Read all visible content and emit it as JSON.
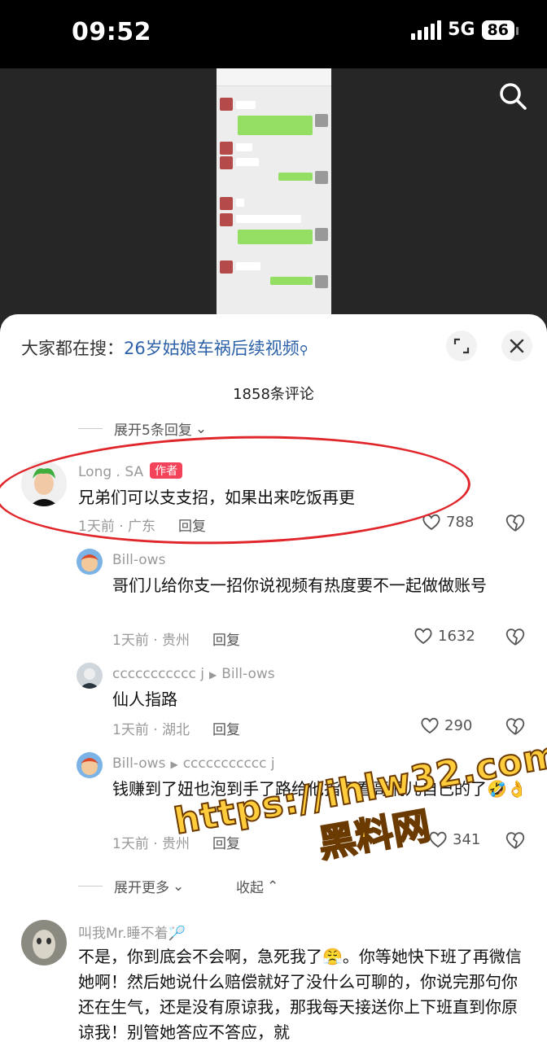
{
  "status_bar": {
    "time": "09:52",
    "network": "5G",
    "battery": "86"
  },
  "sheet": {
    "hot_search_label": "大家都在搜：",
    "hot_search_keyword": "26岁姑娘车祸后续视频",
    "comment_count": "1858条评论",
    "expand_top": "展开5条回复",
    "expand_more": "展开更多",
    "collapse": "收起"
  },
  "comments": [
    {
      "user": "Long . SA",
      "badge": "作者",
      "text": "兄弟们可以支支招，如果出来吃饭再更",
      "time_location": "1天前 · 广东",
      "reply": "回复",
      "likes": "788"
    },
    {
      "user": "Bill-ows",
      "text": "哥们儿给你支一招你说视频有热度要不一起做做账号",
      "time_location": "1天前 · 贵州",
      "reply": "回复",
      "likes": "1632"
    },
    {
      "user": "ccccccccccc j",
      "reply_to": "Bill-ows",
      "text": "仙人指路",
      "time_location": "1天前 · 湖北",
      "reply": "回复",
      "likes": "290"
    },
    {
      "user": "Bill-ows",
      "reply_to": "ccccccccccc j",
      "text": "钱赚到了妞也泡到手了路给他指了看哥们儿自己的了🤣👌",
      "time_location": "1天前 · 贵州",
      "reply": "回复",
      "likes": "341"
    },
    {
      "user": "叫我Mr.睡不着🏸",
      "text": "不是，你到底会不会啊，急死我了😤。你等她快下班了再微信她啊！然后她说什么赔偿就好了没什么可聊的，你说完那句你还在生气，还是没有原谅我，那我每天接送你上下班直到你原谅我！别管她答应不答应，就"
    }
  ],
  "watermark": {
    "url": "https://ihlw32.com",
    "name": "黑料网"
  },
  "colors": {
    "accent_link": "#2d62a8",
    "badge": "#f2435a",
    "annotation": "#e0262b"
  }
}
